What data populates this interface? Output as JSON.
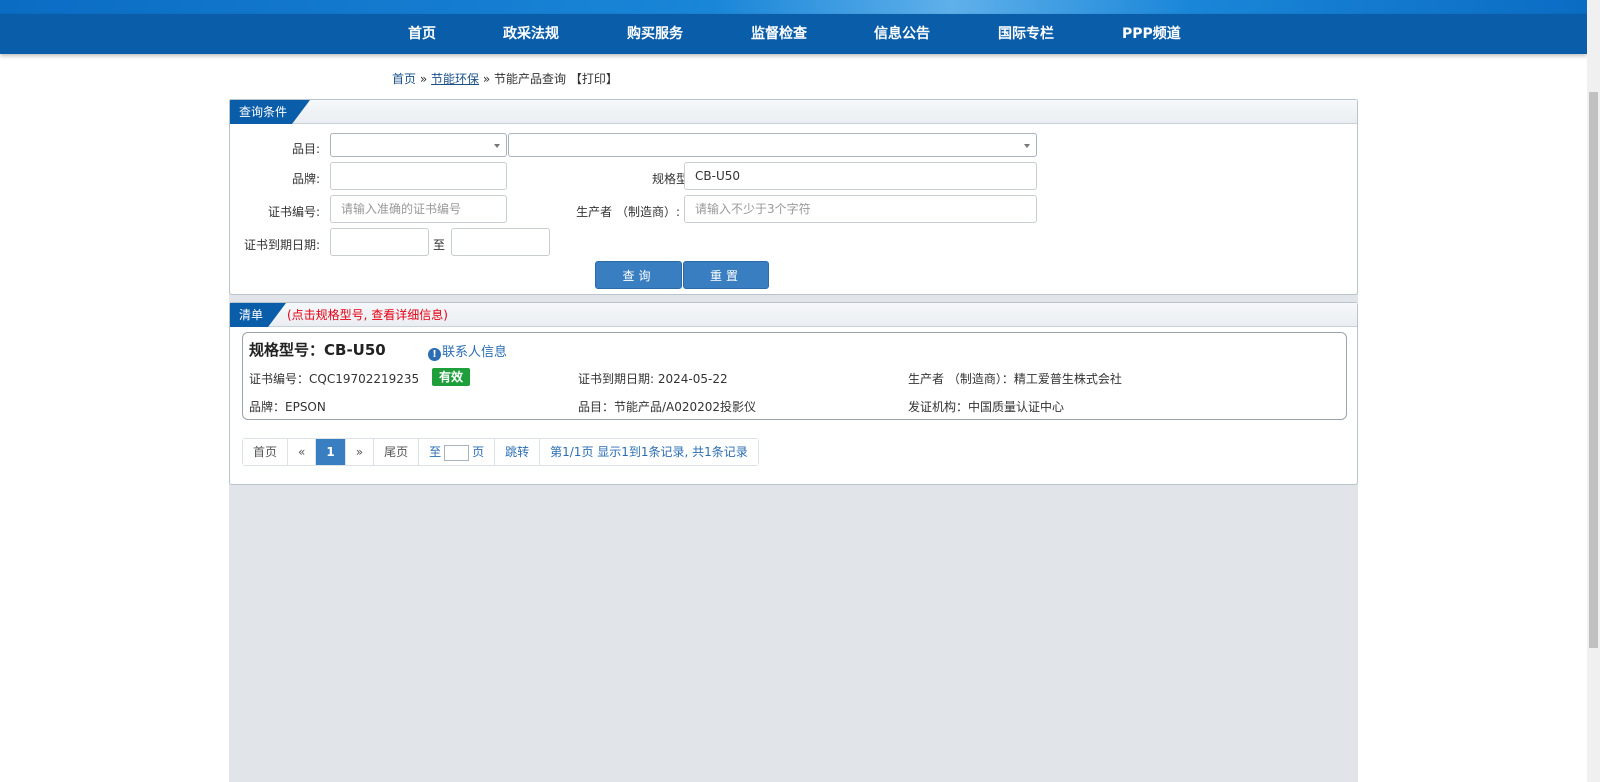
{
  "nav": {
    "items": [
      "首页",
      "政采法规",
      "购买服务",
      "监督检查",
      "信息公告",
      "国际专栏",
      "PPP频道"
    ]
  },
  "breadcrumb": {
    "home": "首页",
    "sep1": " » ",
    "category": "节能环保",
    "sep2": " » ",
    "current": "节能产品查询",
    "print": "【打印】"
  },
  "query": {
    "tab": "查询条件",
    "category_label": "品目:",
    "brand_label": "品牌:",
    "model_label": "规格型号:",
    "model_value": "CB-U50",
    "cert_label": "证书编号:",
    "cert_placeholder": "请输入准确的证书编号",
    "maker_label": "生产者 （制造商）:",
    "maker_placeholder": "请输入不少于3个字符",
    "expiry_label": "证书到期日期:",
    "to_label": "至",
    "search_button": "查询",
    "reset_button": "重置"
  },
  "results": {
    "tab": "清单",
    "note": "(点击规格型号, 查看详细信息)",
    "item": {
      "title": "规格型号：CB-U50",
      "contact": "联系人信息",
      "cert": "证书编号：CQC19702219235",
      "status": "有效",
      "expiry": "证书到期日期: 2024-05-22",
      "maker": "生产者 （制造商）：精工爱普生株式会社",
      "brand": "品牌：EPSON",
      "category": "品目：节能产品/A020202投影仪",
      "issuer": "发证机构：中国质量认证中心"
    }
  },
  "pager": {
    "first": "首页",
    "prev": "«",
    "current": "1",
    "next": "»",
    "last": "尾页",
    "goto_prefix": "至",
    "goto_suffix": "页",
    "jump": "跳转",
    "summary": "第1/1页  显示1到1条记录, 共1条记录"
  }
}
